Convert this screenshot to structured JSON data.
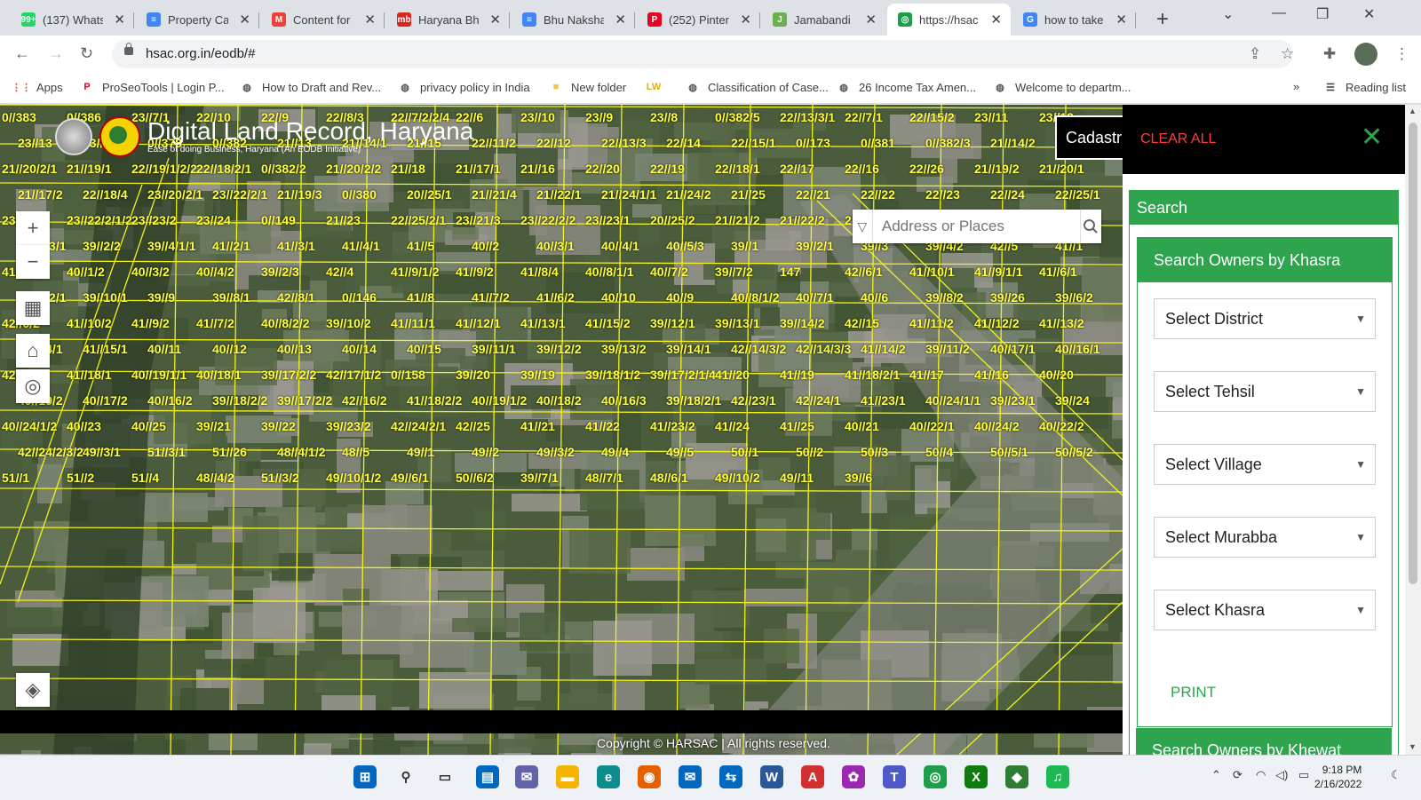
{
  "browser": {
    "tabs": [
      {
        "title": "(137) WhatsApp",
        "icon": "whatsapp-icon",
        "color": "#25d366",
        "glyph": "99+"
      },
      {
        "title": "Property Ca",
        "icon": "docs-icon",
        "color": "#4285f4",
        "glyph": "≡"
      },
      {
        "title": "Content for",
        "icon": "gmail-icon",
        "color": "#ea4335",
        "glyph": "M"
      },
      {
        "title": "Haryana Bhu",
        "icon": "mb-icon",
        "color": "#d7261e",
        "glyph": "mb"
      },
      {
        "title": "Bhu Naksha",
        "icon": "docs-icon",
        "color": "#4285f4",
        "glyph": "≡"
      },
      {
        "title": "(252) Pinterest",
        "icon": "pinterest-icon",
        "color": "#e60023",
        "glyph": "P"
      },
      {
        "title": "Jamabandi",
        "icon": "jamabandi-icon",
        "color": "#6ab04c",
        "glyph": "J"
      },
      {
        "title": "https://hsac",
        "icon": "hsac-icon",
        "color": "#1e9e4a",
        "glyph": "◎"
      },
      {
        "title": "how to take",
        "icon": "google-icon",
        "color": "#4285f4",
        "glyph": "G"
      }
    ],
    "active_tab": 7,
    "url": "hsac.org.in/eodb/#",
    "bookmarks": [
      {
        "label": "Apps",
        "icon": "apps-grid-icon",
        "color": "#ea4335"
      },
      {
        "label": "ProSeoTools | Login P...",
        "icon": "pinterest-icon",
        "color": "#e60023"
      },
      {
        "label": "How to Draft and Rev...",
        "icon": "globe-icon",
        "color": "#555555"
      },
      {
        "label": "privacy policy in India",
        "icon": "globe-icon",
        "color": "#555555"
      },
      {
        "label": "New folder",
        "icon": "folder-icon",
        "color": "#f6c342"
      },
      {
        "label": "",
        "icon": "lw-icon",
        "color": "#e0b400"
      },
      {
        "label": "Classification of Case...",
        "icon": "globe-icon",
        "color": "#555555"
      },
      {
        "label": "26 Income Tax Amen...",
        "icon": "globe-icon",
        "color": "#555555"
      },
      {
        "label": "Welcome to departm...",
        "icon": "globe-icon",
        "color": "#555555"
      }
    ],
    "reading_list": "Reading list"
  },
  "map": {
    "title": "Digital Land Record, Haryana",
    "subtitle": "Ease of doing Business, Haryana (An EODB Initiative)",
    "search_placeholder": "Address or Places",
    "cadastral_label": "Cadastr",
    "copyright": "Copyright © HARSAC | All rights reserved.",
    "plot_labels": [
      "0//383",
      "0//386",
      "23//7/1",
      "22//10",
      "22//9",
      "22//8/3",
      "22//7/2/2/4",
      "22//6",
      "23//10",
      "23//9",
      "23//8",
      "0//382/5",
      "22//13/3/1",
      "22//7/1",
      "22//15/2",
      "23//11",
      "23//12",
      "23//13",
      "23//14",
      "0//378",
      "0//382",
      "21//13",
      "21//14/1",
      "21//15",
      "22//11/2",
      "22//12",
      "22//13/3",
      "22//14",
      "22//15/1",
      "0//173",
      "0//381",
      "0//382/3",
      "21//14/2",
      "22//22/13/7/2",
      "21//20/2/1",
      "21//19/1",
      "22//19/1/2/2",
      "22//18/2/1",
      "0//382/2",
      "21//20/2/2",
      "21//18",
      "21//17/1",
      "21//16",
      "22//20",
      "22//19",
      "22//18/1",
      "22//17",
      "22//16",
      "22//26",
      "21//19/2",
      "21//20/1",
      "21//17/2",
      "22//18/4",
      "23//20/2/1",
      "23//22/2/1",
      "21//19/3",
      "0//380",
      "20//25/1",
      "21//21/4",
      "21//22/1",
      "21//24/1/1",
      "21//24/2",
      "21//25",
      "22//21",
      "22//22",
      "22//23",
      "22//24",
      "22//25/1",
      "23//21/2",
      "23//22/2/1/2",
      "23//23/2",
      "23//24",
      "0//149",
      "21//23",
      "22//25/2/1",
      "23//21/3",
      "23//22/2/2",
      "23//23/1",
      "20//25/2",
      "21//21/2",
      "21//22/2",
      "21//24/1/2",
      "40//1/1",
      "40//5/1",
      "40//5/2",
      "0//17/3/1",
      "39//2/2",
      "39//4/1/1",
      "41//2/1",
      "41//3/1",
      "41//4/1",
      "41//5",
      "40//2",
      "40//3/1",
      "40//4/1",
      "40//5/3",
      "39//1",
      "39//2/1",
      "39//3",
      "39//4/2",
      "42//5",
      "41//1",
      "41//2/2/1",
      "40//1/2",
      "40//3/2",
      "40//4/2",
      "39//2/3",
      "42//4",
      "41//9/1/2",
      "41//9/2",
      "41//8/4",
      "40//8/1/1",
      "40//7/2",
      "39//7/2",
      "147",
      "42//6/1",
      "41//10/1",
      "41//9/1/1",
      "41//6/1",
      "40//8/2/1",
      "39//10/1",
      "39//9",
      "39//8/1",
      "42//8/1",
      "0//146",
      "41//8",
      "41//7/2",
      "41//6/2",
      "40//10",
      "40//9",
      "40//8/1/2",
      "40//7/1",
      "40//6",
      "39//8/2",
      "39//26",
      "39//6/2",
      "42//6/2",
      "41//10/2",
      "41//9/2",
      "41//7/2",
      "40//8/2/2",
      "39//10/2",
      "41//11/1",
      "41//12/1",
      "41//13/1",
      "41//15/2",
      "39//12/1",
      "39//13/1",
      "39//14/2",
      "42//15",
      "41//11/2",
      "41//12/2",
      "41//13/2",
      "41//14/1",
      "41//15/1",
      "40//11",
      "40//12",
      "40//13",
      "40//14",
      "40//15",
      "39//11/1",
      "39//12/2",
      "39//13/2",
      "39//14/1",
      "42//14/3/2",
      "42//14/3/3",
      "41//14/2",
      "39//11/2",
      "40//17/1",
      "40//16/1",
      "42//16/1",
      "41//18/1",
      "40//19/1/1",
      "40//18/1",
      "39//17/2/2",
      "42//17/1/2",
      "0//158",
      "39//20",
      "39//19",
      "39//18/1/2",
      "39//17/2/1/4",
      "41//20",
      "41//19",
      "41//18/2/1",
      "41//17",
      "41//16",
      "40//20",
      "40//19/2",
      "40//17/2",
      "40//16/2",
      "39//18/2/2",
      "39//17/2/2",
      "42//16/2",
      "41//18/2/2",
      "40//19/1/2",
      "40//18/2",
      "40//16/3",
      "39//18/2/1",
      "42//23/1",
      "42//24/1",
      "41//23/1",
      "40//24/1/1",
      "39//23/1",
      "39//24",
      "40//24/1/2",
      "40//23",
      "40//25",
      "39//21",
      "39//22",
      "39//23/2",
      "42//24/2/1",
      "42//25",
      "41//21",
      "41//22",
      "41//23/2",
      "41//24",
      "41//25",
      "40//21",
      "40//22/1",
      "40//24/2",
      "40//22/2",
      "42//24/2/3/2",
      "49//3/1",
      "51//3/1",
      "51//26",
      "48//4/1/2",
      "48//5",
      "49//1",
      "49//2",
      "49//3/2",
      "49//4",
      "49//5",
      "50//1",
      "50//2",
      "50//3",
      "50//4",
      "50//5/1",
      "50//5/2",
      "51//1",
      "51//2",
      "51//4",
      "48//4/2",
      "51//3/2",
      "49//10/1/2",
      "49//6/1",
      "50//6/2",
      "39//7/1",
      "48//7/1",
      "48//6/1",
      "49//10/2",
      "49//11",
      "39//6"
    ]
  },
  "map_controls": [
    {
      "name": "zoom-in-button",
      "glyph": "+"
    },
    {
      "name": "zoom-out-button",
      "glyph": "−"
    },
    {
      "name": "qr-code-button",
      "glyph": "▦"
    },
    {
      "name": "home-button",
      "glyph": "⌂"
    },
    {
      "name": "locate-button",
      "glyph": "◎"
    },
    {
      "name": "layers-button",
      "glyph": "◈"
    }
  ],
  "panel": {
    "clear_all": "CLEAR ALL",
    "search_title": "Search",
    "khasra_title": "Search Owners by Khasra",
    "selects": [
      "Select District",
      "Select Tehsil",
      "Select Village",
      "Select Murabba",
      "Select Khasra"
    ],
    "print_label": "PRINT",
    "khewat_title": "Search Owners by Khewat"
  },
  "taskbar": {
    "apps": [
      {
        "name": "start-icon",
        "color": "#0067c0",
        "glyph": "⊞"
      },
      {
        "name": "search-icon",
        "color": "#333333",
        "glyph": "⚲"
      },
      {
        "name": "task-view-icon",
        "color": "#333333",
        "glyph": "▭"
      },
      {
        "name": "widgets-icon",
        "color": "#0067c0",
        "glyph": "▤"
      },
      {
        "name": "chat-icon",
        "color": "#6264a7",
        "glyph": "✉"
      },
      {
        "name": "file-explorer-icon",
        "color": "#f4b400",
        "glyph": "▬"
      },
      {
        "name": "edge-icon",
        "color": "#0c8c8c",
        "glyph": "e"
      },
      {
        "name": "firefox-icon",
        "color": "#e66000",
        "glyph": "◉"
      },
      {
        "name": "mail-icon",
        "color": "#0067c0",
        "glyph": "✉"
      },
      {
        "name": "remote-icon",
        "color": "#0067c0",
        "glyph": "⇆"
      },
      {
        "name": "word-icon",
        "color": "#2b579a",
        "glyph": "W"
      },
      {
        "name": "acrobat-icon",
        "color": "#d32f2f",
        "glyph": "A"
      },
      {
        "name": "picasa-icon",
        "color": "#9c27b0",
        "glyph": "✿"
      },
      {
        "name": "teams-icon",
        "color": "#5059c9",
        "glyph": "T"
      },
      {
        "name": "chrome-icon",
        "color": "#1e9e4a",
        "glyph": "◎"
      },
      {
        "name": "xbox-icon",
        "color": "#107c10",
        "glyph": "X"
      },
      {
        "name": "maps-icon",
        "color": "#2e7d32",
        "glyph": "◆"
      },
      {
        "name": "spotify-icon",
        "color": "#1db954",
        "glyph": "♫"
      }
    ],
    "time": "9:18 PM",
    "date": "2/16/2022"
  }
}
